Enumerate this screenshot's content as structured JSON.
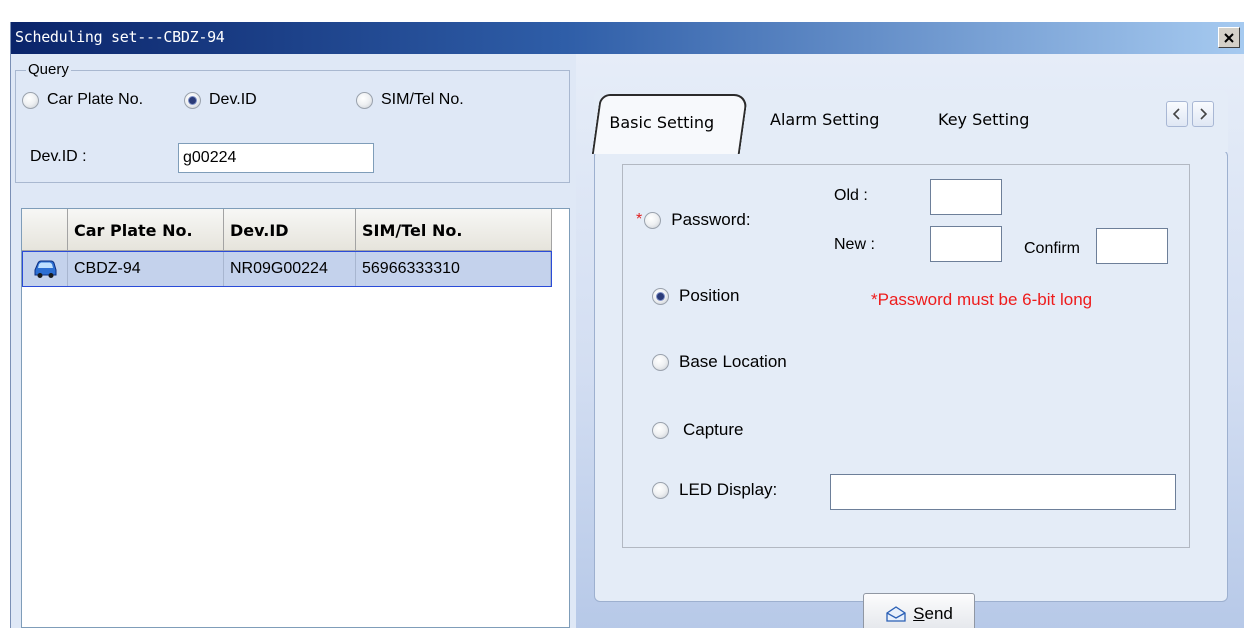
{
  "window": {
    "title": "Scheduling set---CBDZ-94"
  },
  "query": {
    "legend": "Query",
    "options": [
      {
        "label": "Car Plate No.",
        "checked": false
      },
      {
        "label": "Dev.ID",
        "checked": true
      },
      {
        "label": "SIM/Tel No.",
        "checked": false
      }
    ],
    "devid_label": "Dev.ID :",
    "devid_value": "g00224"
  },
  "grid": {
    "columns": [
      "",
      "Car Plate No.",
      "Dev.ID",
      "SIM/Tel No."
    ],
    "rows": [
      {
        "icon": "car-icon",
        "car_plate": "CBDZ-94",
        "dev_id": "NR09G00224",
        "sim": "56966333310"
      }
    ]
  },
  "tabs": [
    {
      "label": "Basic Setting",
      "active": true
    },
    {
      "label": "Alarm Setting",
      "active": false
    },
    {
      "label": "Key Setting",
      "active": false
    }
  ],
  "basic": {
    "required_mark": "*",
    "password_label": "Password:",
    "old_label": "Old :",
    "new_label": "New :",
    "confirm_label": "Confirm",
    "position_label": "Position",
    "position_checked": true,
    "password_note": "*Password must be 6-bit long",
    "base_location_label": "Base Location",
    "capture_label": "Capture",
    "led_label": "LED Display:",
    "led_value": ""
  },
  "send": {
    "label": "Send",
    "accel": "S",
    "rest": "end"
  },
  "colors": {
    "titlebar_start": "#0a246a",
    "selected_row": "#c4d2ec",
    "note_red": "#ee1c1c"
  }
}
